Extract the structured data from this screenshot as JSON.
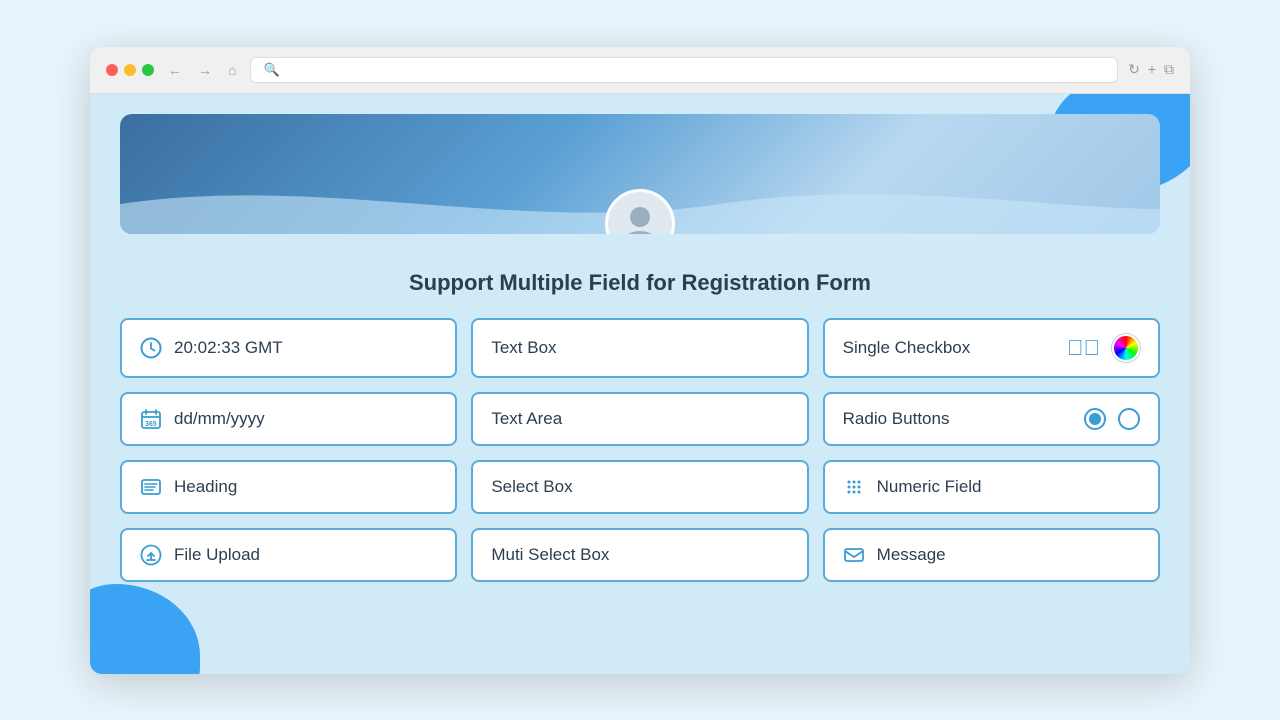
{
  "browser": {
    "dots": [
      "red",
      "yellow",
      "green"
    ],
    "nav_back": "←",
    "nav_forward": "→",
    "nav_home": "⌂",
    "address_icon": "🔍",
    "address_text": "",
    "refresh": "↻",
    "new_tab": "+",
    "tabs": "⧉"
  },
  "page": {
    "title": "Support Multiple Field for Registration Form",
    "clock_value": "20:02:33 GMT",
    "date_placeholder": "dd/mm/yyyy",
    "fields": [
      {
        "id": "clock",
        "label": "20:02:33 GMT",
        "icon": "clock",
        "col": 0,
        "row": 0
      },
      {
        "id": "date",
        "label": "dd/mm/yyyy",
        "icon": "calendar",
        "col": 0,
        "row": 1
      },
      {
        "id": "heading",
        "label": "Heading",
        "icon": "lines",
        "col": 0,
        "row": 2
      },
      {
        "id": "file-upload",
        "label": "File Upload",
        "icon": "upload",
        "col": 0,
        "row": 3
      },
      {
        "id": "text-box",
        "label": "Text Box",
        "icon": "none",
        "col": 1,
        "row": 0
      },
      {
        "id": "text-area",
        "label": "Text Area",
        "icon": "none",
        "col": 1,
        "row": 1
      },
      {
        "id": "select-box",
        "label": "Select Box",
        "icon": "none",
        "col": 1,
        "row": 2
      },
      {
        "id": "multi-select",
        "label": "Muti Select Box",
        "icon": "none",
        "col": 1,
        "row": 3
      },
      {
        "id": "numeric-field",
        "label": "Numeric Field",
        "icon": "grid",
        "col": 2,
        "row": 2
      },
      {
        "id": "message",
        "label": "Message",
        "icon": "envelope",
        "col": 2,
        "row": 3
      }
    ],
    "single_checkbox_label": "Single Checkbox",
    "radio_buttons_label": "Radio Buttons"
  }
}
